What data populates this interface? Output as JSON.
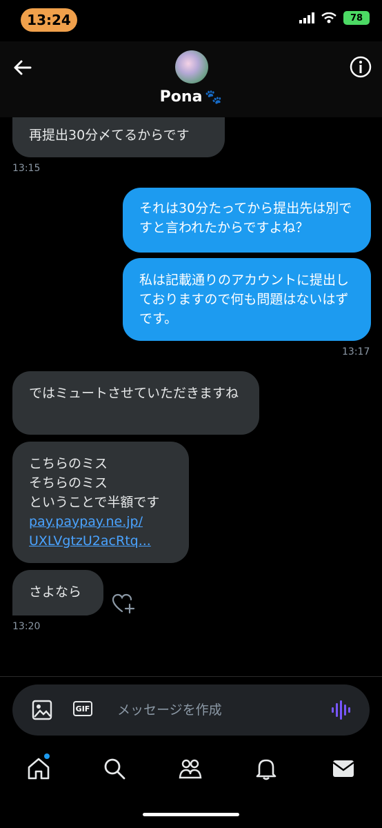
{
  "status_bar": {
    "time": "13:24",
    "battery": "78"
  },
  "header": {
    "back_label": "←",
    "name": "Pona",
    "name_emoji": "🐾"
  },
  "messages": [
    {
      "text": "再提出30分〆てるからです",
      "time": "13:15"
    },
    {
      "text": "それは30分たってから提出先は別ですと言われたからですよね？"
    },
    {
      "text": "私は記載通りのアカウントに提出しておりますので何も問題はないはずです。",
      "time": "13:17"
    },
    {
      "text": "ではミュートさせていただきますね"
    },
    {
      "lines": [
        "こちらのミス",
        "そちらのミス",
        "ということで半額です"
      ],
      "link_1": "pay.paypay.ne.jp/",
      "link_2": "UXLVgtzU2acRtq..."
    },
    {
      "text": "さよなら",
      "time": "13:20"
    }
  ],
  "composer": {
    "placeholder": "メッセージを作成",
    "gif_label": "GIF"
  }
}
